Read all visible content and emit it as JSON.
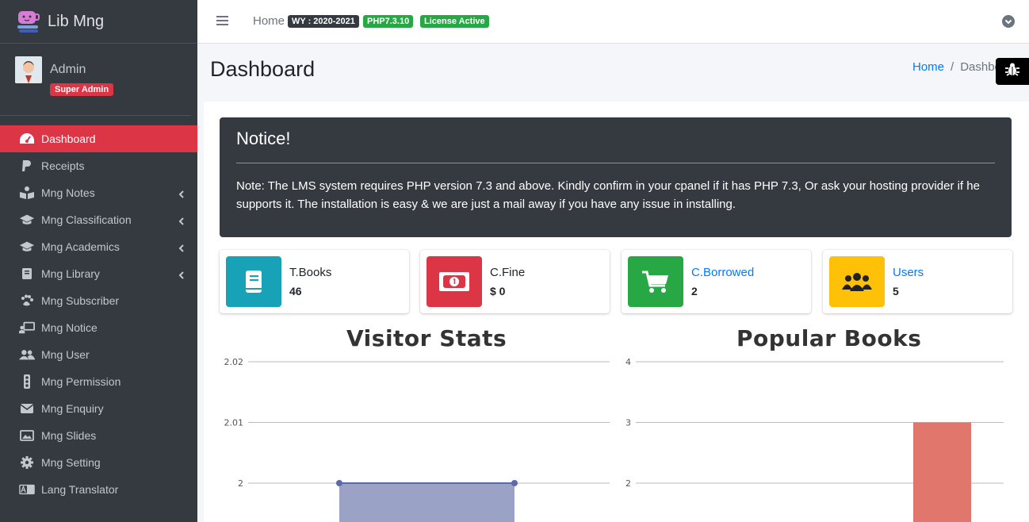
{
  "brand": {
    "name": "Lib Mng"
  },
  "user": {
    "name": "Admin",
    "role": "Super Admin"
  },
  "sidebar": {
    "items": [
      {
        "label": "Dashboard",
        "icon": "tachometer-icon",
        "active": true,
        "submenu": false
      },
      {
        "label": "Receipts",
        "icon": "paypal-icon",
        "submenu": false
      },
      {
        "label": "Mng Notes",
        "icon": "book-reader-icon",
        "submenu": true
      },
      {
        "label": "Mng Classification",
        "icon": "graduation-cap-icon",
        "submenu": true
      },
      {
        "label": "Mng Academics",
        "icon": "graduation-cap-icon",
        "submenu": true
      },
      {
        "label": "Mng Library",
        "icon": "book-icon",
        "submenu": true
      },
      {
        "label": "Mng Subscriber",
        "icon": "paw-icon",
        "submenu": false
      },
      {
        "label": "Mng Notice",
        "icon": "chalkboard-teacher-icon",
        "submenu": false
      },
      {
        "label": "Mng User",
        "icon": "users-icon",
        "submenu": false
      },
      {
        "label": "Mng Permission",
        "icon": "traffic-light-icon",
        "submenu": false
      },
      {
        "label": "Mng Enquiry",
        "icon": "envelope-icon",
        "submenu": false
      },
      {
        "label": "Mng Slides",
        "icon": "image-icon",
        "submenu": false
      },
      {
        "label": "Mng Setting",
        "icon": "gear-icon",
        "submenu": false
      },
      {
        "label": "Lang Translator",
        "icon": "language-icon",
        "submenu": false
      }
    ]
  },
  "topbar": {
    "home_label": "Home",
    "year_badge": "WY : 2020-2021",
    "php_badge": "PHP7.3.10",
    "license_badge": "License Active"
  },
  "page": {
    "title": "Dashboard"
  },
  "breadcrumb": {
    "home": "Home",
    "current": "Dashboard"
  },
  "notice": {
    "title": "Notice!",
    "text": "Note: The LMS system requires PHP version 7.3 and above. Kindly confirm in your cpanel if it has PHP 7.3, Or ask your hosting provider if he supports it. The installation is easy & we are just a mail away if you have any issue in installing."
  },
  "stats": [
    {
      "label": "T.Books",
      "value": "46",
      "color": "#17a2b8",
      "icon": "book-icon",
      "link": false
    },
    {
      "label": "C.Fine",
      "value": "$ 0",
      "color": "#dc3545",
      "icon": "money-bill-icon",
      "link": false
    },
    {
      "label": "C.Borrowed",
      "value": "2",
      "color": "#28a745",
      "icon": "shopping-cart-icon",
      "link": true
    },
    {
      "label": "Users",
      "value": "5",
      "color": "#ffc107",
      "icon": "users-icon",
      "link": true
    }
  ],
  "colors": {
    "sidebar": "#343a40",
    "active": "#dc3545",
    "link": "#007bff",
    "visitor_fill": "#9aa3c6",
    "visitor_line": "#5b6aaa",
    "popular_bar": "#e0766c"
  },
  "chart_data": [
    {
      "type": "area",
      "title": "Visitor Stats",
      "y_ticks": [
        "2.02",
        "2.01",
        "2"
      ],
      "ylim": [
        1.99,
        2.02
      ],
      "series": [
        {
          "values": [
            2,
            2
          ]
        }
      ],
      "grid": true
    },
    {
      "type": "bar",
      "title": "Popular Books",
      "y_ticks": [
        "4",
        "3",
        "2"
      ],
      "ylim": [
        1,
        4
      ],
      "series": [
        {
          "values": [
            3
          ]
        }
      ],
      "grid": true
    }
  ]
}
